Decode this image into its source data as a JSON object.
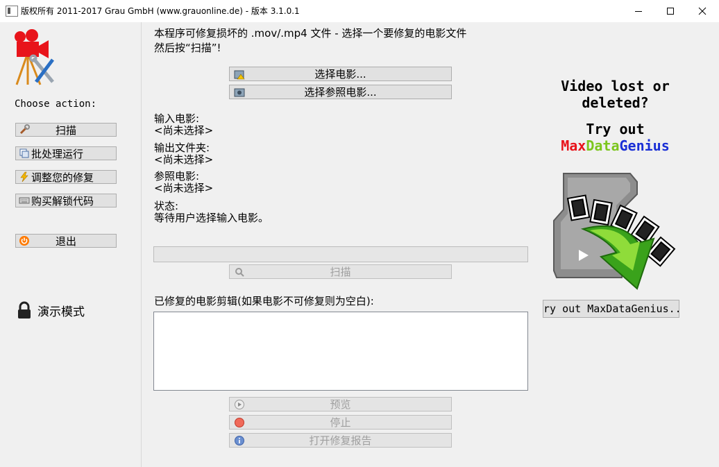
{
  "window": {
    "title": "版权所有 2011-2017 Grau GmbH (www.grauonline.de) - 版本 3.1.0.1"
  },
  "sidebar": {
    "choose_label": "Choose action:",
    "actions": [
      {
        "label": "扫描",
        "icon": "wrench-icon"
      },
      {
        "label": "批处理运行",
        "icon": "batch-icon"
      },
      {
        "label": "调整您的修复",
        "icon": "lightning-icon"
      },
      {
        "label": "购买解锁代码",
        "icon": "keyboard-icon"
      }
    ],
    "exit_label": "退出",
    "demo_label": "演示模式"
  },
  "main": {
    "description_line1": "本程序可修复损坏的 .mov/.mp4 文件 - 选择一个要修复的电影文件",
    "description_line2": "然后按“扫描”!",
    "select_movie_label": "选择电影...",
    "select_reference_label": "选择参照电影...",
    "input_movie_label": "输入电影:",
    "input_movie_value": "<尚未选择>",
    "output_folder_label": "输出文件夹:",
    "output_folder_value": "<尚未选择>",
    "reference_movie_label": "参照电影:",
    "reference_movie_value": "<尚未选择>",
    "status_label": "状态:",
    "status_value": "等待用户选择输入电影。",
    "progress": 0,
    "scan_label": "扫描",
    "repaired_clips_label": "已修复的电影剪辑(如果电影不可修复则为空白):",
    "preview_label": "预览",
    "stop_label": "停止",
    "open_report_label": "打开修复报告"
  },
  "promo": {
    "line1": "Video lost or",
    "line2": "deleted?",
    "line3": "Try out",
    "brand_part1": "Max",
    "brand_part2": "Data",
    "brand_part3": "Genius",
    "button_label": "ry out MaxDataGenius..",
    "colors": {
      "max": "#e8141b",
      "data": "#7cc61d",
      "genius": "#1a2fd6"
    }
  }
}
